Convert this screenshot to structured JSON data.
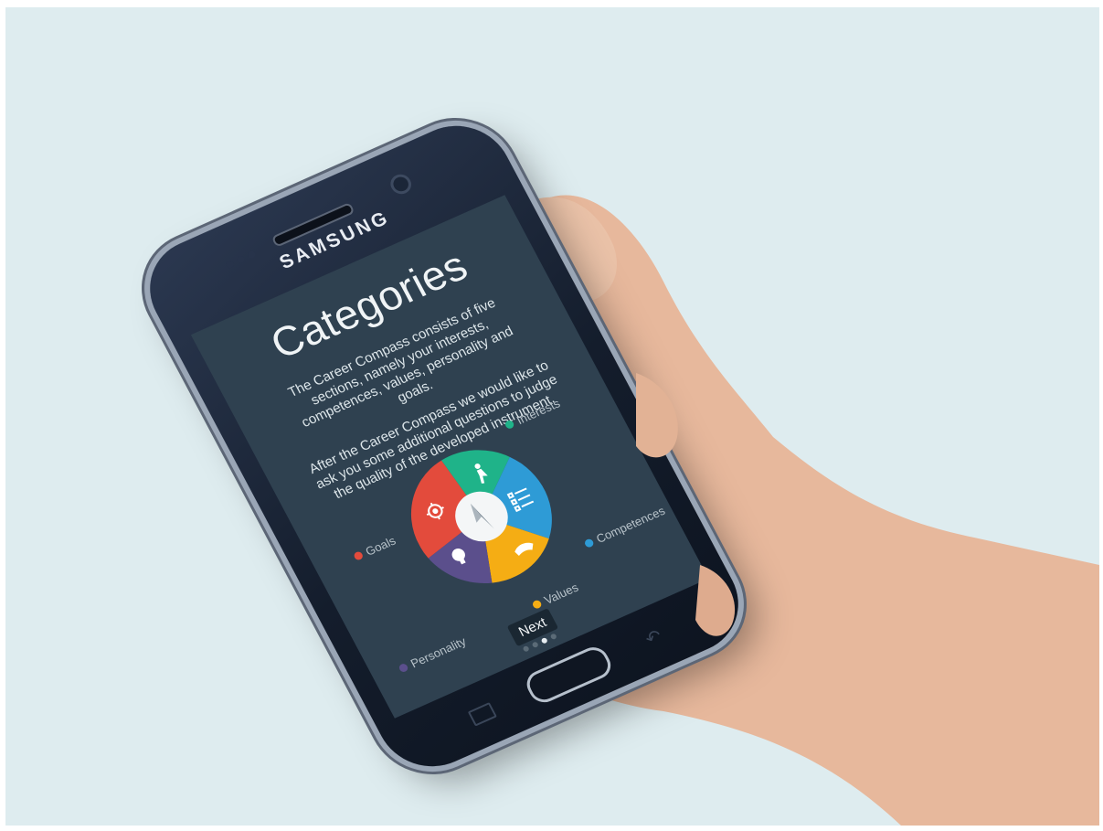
{
  "phone": {
    "brand": "SAMSUNG"
  },
  "screen": {
    "title": "Categories",
    "paragraph_1": "The Career Compass consists of five sections, namely your interests, competences, values, personality and goals.",
    "paragraph_2": "After the Career Compass we would like to ask you some additional questions to judge the quality of the developed instrument.",
    "categories": [
      {
        "label": "Interests",
        "color": "#1fb389",
        "icon": "walking-person-icon"
      },
      {
        "label": "Competences",
        "color": "#2e9bd6",
        "icon": "checklist-icon"
      },
      {
        "label": "Values",
        "color": "#f5ad14",
        "icon": "handshake-icon"
      },
      {
        "label": "Personality",
        "color": "#5b4f8c",
        "icon": "head-gear-icon"
      },
      {
        "label": "Goals",
        "color": "#e34b3c",
        "icon": "target-icon"
      }
    ],
    "center_icon": "compass-icon",
    "next_label": "Next",
    "pager": {
      "total": 4,
      "active": 3
    }
  },
  "colors": {
    "background": "#deecef",
    "screen": "#2f4150",
    "phone_body": "#1a2332"
  }
}
